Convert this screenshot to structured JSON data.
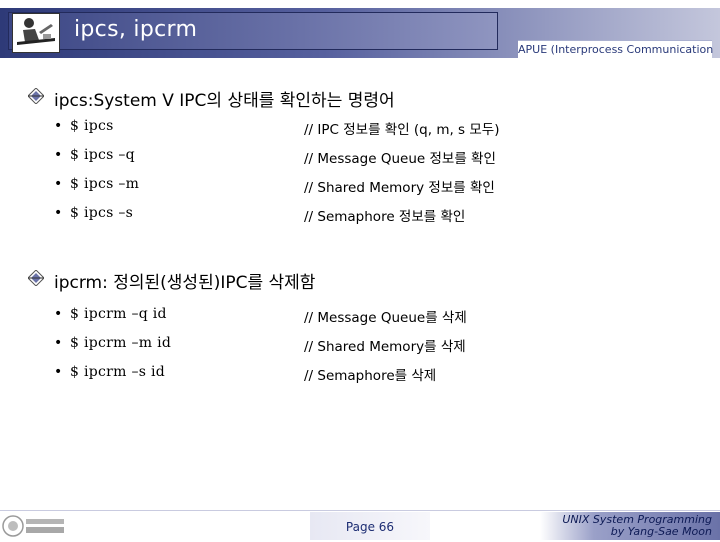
{
  "header": {
    "title": "ipcs, ipcrm",
    "course": "APUE (Interprocess Communication",
    "logo_icon": "teacher-at-desk-icon"
  },
  "sections": [
    {
      "heading": "ipcs:System V IPC의 상태를 확인하는 명령어",
      "rows": [
        {
          "bullet": "•",
          "command": "$ ipcs",
          "comment": "// IPC 정보를 확인 (q, m, s 모두)"
        },
        {
          "bullet": "•",
          "command": "$ ipcs –q",
          "comment": "// Message Queue 정보를 확인"
        },
        {
          "bullet": "•",
          "command": "$ ipcs –m",
          "comment": "// Shared Memory 정보를 확인"
        },
        {
          "bullet": "•",
          "command": "$ ipcs –s",
          "comment": "// Semaphore 정보를 확인"
        }
      ]
    },
    {
      "heading": "ipcrm: 정의된(생성된)IPC를 삭제함",
      "rows": [
        {
          "bullet": "•",
          "command": "$ ipcrm –q id",
          "comment": "// Message Queue를 삭제"
        },
        {
          "bullet": "•",
          "command": "$ ipcrm –m id",
          "comment": "// Shared Memory를 삭제"
        },
        {
          "bullet": "•",
          "command": "$ ipcrm –s id",
          "comment": "// Semaphore를 삭제"
        }
      ]
    }
  ],
  "footer": {
    "page": "Page 66",
    "book_line1": "UNIX System Programming",
    "book_line2": "by Yang-Sae Moon",
    "university_logo_icon": "university-logo-icon"
  },
  "colors": {
    "header_dark": "#2e3a78",
    "header_light": "#c4c7dc",
    "accent_text": "#1d2d73"
  }
}
